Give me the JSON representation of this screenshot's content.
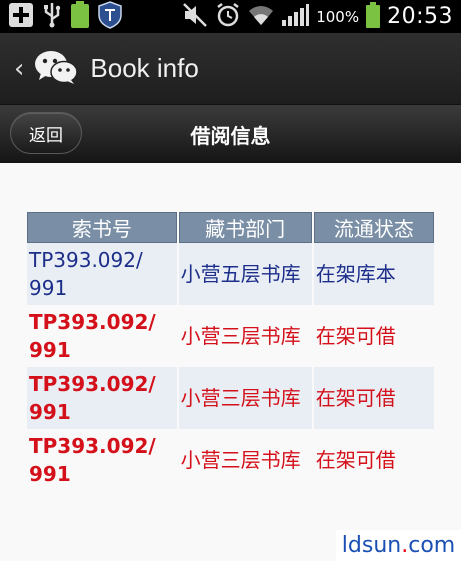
{
  "status_bar": {
    "battery_percent_text": "100%",
    "time": "20:53",
    "icons": [
      "add-icon",
      "usb-icon",
      "battery-small-icon",
      "shield-icon",
      "mute-icon",
      "alarm-icon",
      "wifi-icon",
      "signal-icon",
      "battery-icon"
    ]
  },
  "app_bar": {
    "title": "Book info"
  },
  "nav": {
    "return_label": "返回",
    "title": "借阅信息"
  },
  "table": {
    "headers": [
      "索书号",
      "藏书部门",
      "流通状态"
    ],
    "rows": [
      {
        "call_no": "TP393.092/\n991",
        "dept": "小营五层书库",
        "status": "在架库本",
        "color": "blue"
      },
      {
        "call_no": "TP393.092/\n991",
        "dept": "小营三层书库",
        "status": "在架可借",
        "color": "red"
      },
      {
        "call_no": "TP393.092/\n991",
        "dept": "小营三层书库",
        "status": "在架可借",
        "color": "red"
      },
      {
        "call_no": "TP393.092/\n991",
        "dept": "小营三层书库",
        "status": "在架可借",
        "color": "red"
      }
    ]
  },
  "watermark": {
    "left": "ldsun",
    "dot": ".",
    "right": "com"
  },
  "colors": {
    "header_bg": "#7a8fa6",
    "blue_text": "#1c2d8a",
    "red_text": "#d4101a"
  }
}
